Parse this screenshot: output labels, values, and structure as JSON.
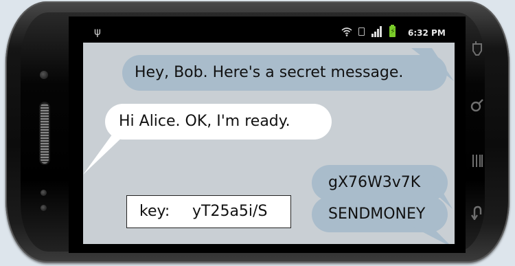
{
  "status_bar": {
    "time": "6:32 PM",
    "icons": [
      "usb-icon",
      "wifi-icon",
      "sim-icon",
      "signal-icon",
      "battery-charging-icon"
    ]
  },
  "messages": [
    {
      "from": "Alice",
      "text": "Hey, Bob. Here's a secret message."
    },
    {
      "from": "Bob",
      "text": "Hi Alice. OK, I'm ready."
    },
    {
      "from": "Alice",
      "text": "gX76W3v7K"
    },
    {
      "from": "Alice",
      "text": "SENDMONEY"
    }
  ],
  "key_box": {
    "label": "key:",
    "value": "yT25a5i/S"
  },
  "softkeys": [
    "menu-key-icon",
    "search-key-icon",
    "recent-key-icon",
    "back-key-icon"
  ],
  "colors": {
    "outgoing_bubble": "#a9bccb",
    "incoming_bubble": "#ffffff",
    "chat_background": "#c9cfd4",
    "battery": "#7acc2a"
  }
}
